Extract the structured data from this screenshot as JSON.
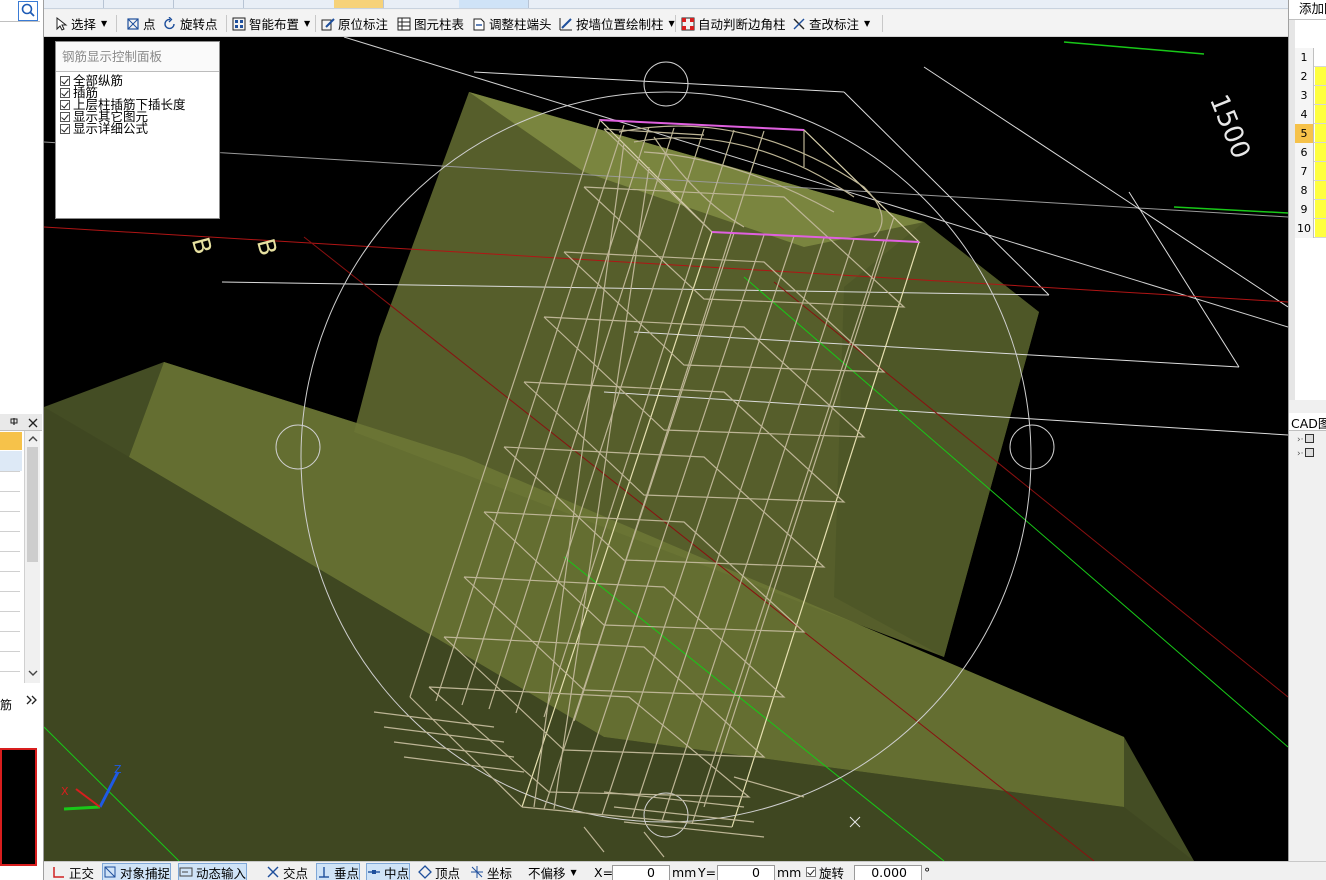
{
  "toolbar": {
    "items": [
      {
        "label": "选择",
        "icon": "cursor-icon",
        "dropdown": true
      },
      {
        "label": "点",
        "icon": "point-icon"
      },
      {
        "label": "旋转点",
        "icon": "rotate-point-icon"
      },
      {
        "label": "智能布置",
        "icon": "smart-layout-icon",
        "dropdown": true
      },
      {
        "label": "原位标注",
        "icon": "in-place-annotation-icon"
      },
      {
        "label": "图元柱表",
        "icon": "element-column-table-icon"
      },
      {
        "label": "调整柱端头",
        "icon": "adjust-column-end-icon"
      },
      {
        "label": "按墙位置绘制柱",
        "icon": "draw-column-by-wall-icon",
        "dropdown": true
      },
      {
        "label": "自动判断边角柱",
        "icon": "auto-corner-column-icon"
      },
      {
        "label": "查改标注",
        "icon": "check-annotation-icon",
        "dropdown": true
      }
    ]
  },
  "control_panel": {
    "title": "钢筋显示控制面板",
    "options": [
      {
        "label": "全部纵筋",
        "checked": true
      },
      {
        "label": "插筋",
        "checked": true
      },
      {
        "label": "上层柱插筋下插长度",
        "checked": true
      },
      {
        "label": "显示其它图元",
        "checked": true
      },
      {
        "label": "显示详细公式",
        "checked": true
      }
    ]
  },
  "right_panel": {
    "header": "添加图",
    "rows": [
      "1",
      "2",
      "3",
      "4",
      "5",
      "6",
      "7",
      "8",
      "9",
      "10"
    ],
    "selected_row": "5",
    "cad_header": "CAD图层"
  },
  "left_panel": {
    "label": "筋"
  },
  "viewport": {
    "background": "#000000",
    "cad_text": [
      "1500",
      "B",
      "B"
    ],
    "axis_labels": {
      "z": "Z",
      "x": "X"
    }
  },
  "status_bar": {
    "items": [
      {
        "label": "正交",
        "icon": "ortho-icon",
        "on": false
      },
      {
        "label": "对象捕捉",
        "icon": "object-snap-icon",
        "on": true
      },
      {
        "label": "动态输入",
        "icon": "dynamic-input-icon",
        "on": true
      },
      {
        "label": "交点",
        "icon": "intersection-icon",
        "on": false
      },
      {
        "label": "垂点",
        "icon": "perpendicular-icon",
        "on": true
      },
      {
        "label": "中点",
        "icon": "midpoint-icon",
        "on": true
      },
      {
        "label": "顶点",
        "icon": "vertex-icon",
        "on": false
      },
      {
        "label": "坐标",
        "icon": "coordinate-icon",
        "on": false
      }
    ],
    "offset_mode": "不偏移",
    "x_label": "X=",
    "x_value": "0",
    "unit_x": "mm",
    "y_label": "Y=",
    "y_value": "0",
    "unit_y": "mm",
    "rotate_label": "旋转",
    "rotate_value": "0.000",
    "degree": "°"
  }
}
